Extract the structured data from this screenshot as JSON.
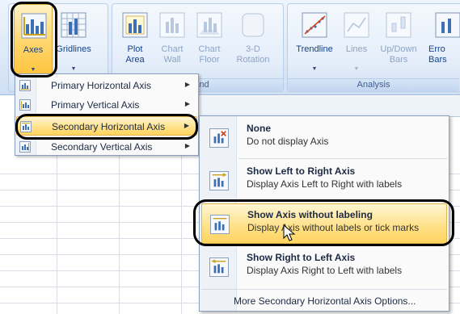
{
  "ribbon": {
    "buttons": [
      {
        "id": "axes",
        "label": "Axes"
      },
      {
        "id": "gridlines",
        "label": "Gridlines"
      },
      {
        "id": "plot-area",
        "label": "Plot\nArea"
      },
      {
        "id": "chart-wall",
        "label": "Chart\nWall"
      },
      {
        "id": "chart-floor",
        "label": "Chart\nFloor"
      },
      {
        "id": "3d-rotation",
        "label": "3-D\nRotation"
      },
      {
        "id": "trendline",
        "label": "Trendline"
      },
      {
        "id": "lines",
        "label": "Lines"
      },
      {
        "id": "up-down-bars",
        "label": "Up/Down\nBars"
      },
      {
        "id": "error-bars",
        "label": "Erro\nBars"
      }
    ],
    "group_labels": {
      "background": "round",
      "analysis": "Analysis"
    }
  },
  "axes_menu": {
    "items": [
      {
        "label": "Primary Horizontal Axis"
      },
      {
        "label": "Primary Vertical Axis"
      },
      {
        "label": "Secondary Horizontal Axis"
      },
      {
        "label": "Secondary Vertical Axis"
      }
    ]
  },
  "submenu": {
    "items": [
      {
        "title": "None",
        "description": "Do not display Axis"
      },
      {
        "title": "Show Left to Right Axis",
        "description": "Display Axis Left to Right with labels"
      },
      {
        "title": "Show Axis without labeling",
        "description": "Display Axis without labels or tick marks"
      },
      {
        "title": "Show Right to Left Axis",
        "description": "Display Axis Right to Left with labels"
      }
    ],
    "more_options": "More Secondary Horizontal Axis Options..."
  }
}
